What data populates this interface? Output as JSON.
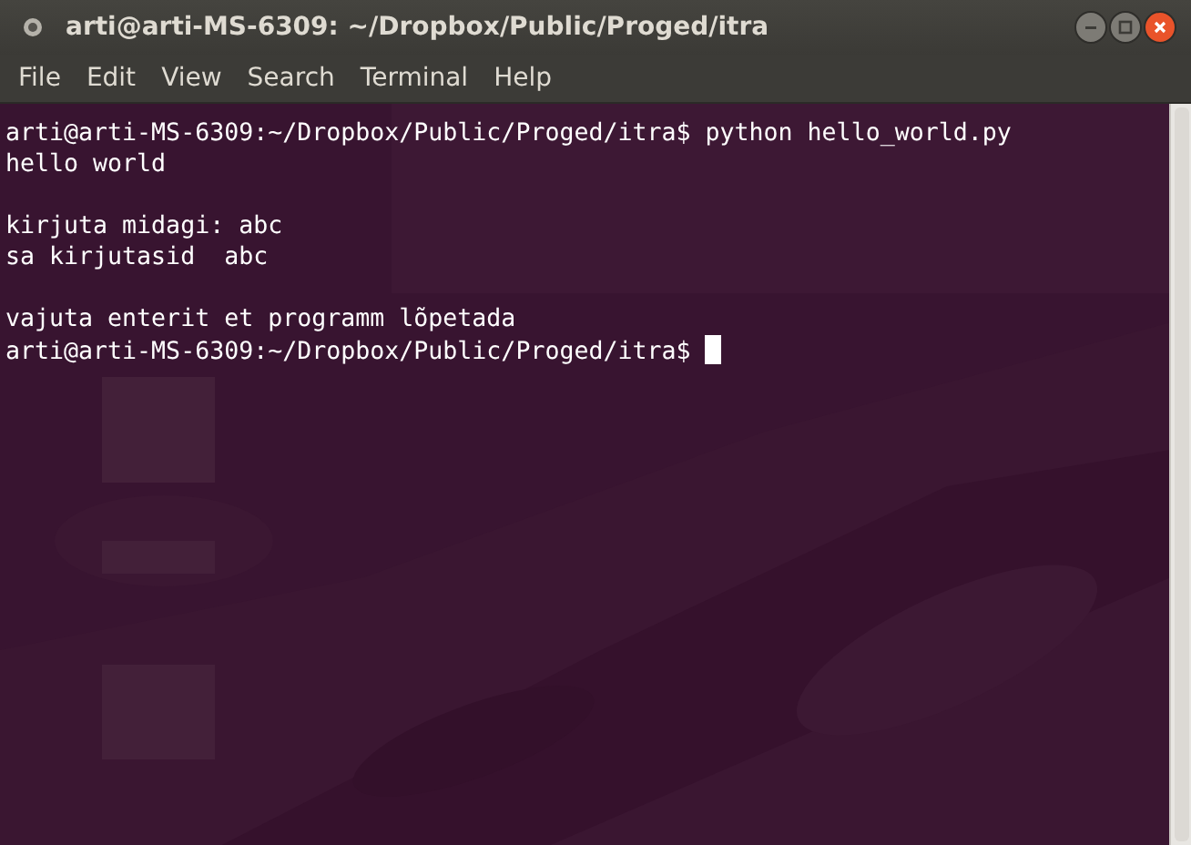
{
  "window": {
    "title": "arti@arti-MS-6309: ~/Dropbox/Public/Proged/itra"
  },
  "menu": [
    "File",
    "Edit",
    "View",
    "Search",
    "Terminal",
    "Help"
  ],
  "terminal": {
    "blocks": [
      {
        "lines": [
          {
            "text": "arti@arti-MS-6309:~/Dropbox/Public/Proged/itra$ python hello_world.py",
            "cursor": false
          },
          {
            "text": "hello world",
            "cursor": false
          }
        ]
      },
      {
        "lines": [
          {
            "text": "kirjuta midagi: abc",
            "cursor": false
          },
          {
            "text": "sa kirjutasid  abc",
            "cursor": false
          }
        ]
      },
      {
        "lines": [
          {
            "text": "vajuta enterit et programm lõpetada",
            "cursor": false
          },
          {
            "text": "arti@arti-MS-6309:~/Dropbox/Public/Proged/itra$ ",
            "cursor": true
          }
        ]
      }
    ]
  }
}
